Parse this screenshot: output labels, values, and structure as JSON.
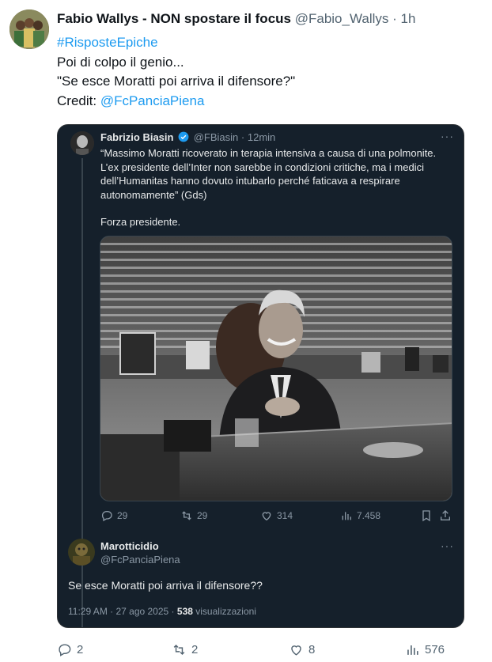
{
  "tweet": {
    "author_name": "Fabio Wallys - NON spostare il focus",
    "author_handle": "@Fabio_Wallys",
    "separator": "·",
    "time": "1h",
    "hashtag": "#RisposteEpiche",
    "line1": "Poi di colpo il genio...",
    "line2": "\"Se esce Moratti poi arriva il difensore?\"",
    "credit_label": "Credit:",
    "credit_mention": "@FcPanciaPiena"
  },
  "quoted": {
    "author_name": "Fabrizio Biasin",
    "author_handle": "@FBiasin",
    "separator": "·",
    "time": "12min",
    "text1": "“Massimo Moratti ricoverato in terapia intensiva a causa di una polmonite. L’ex presidente dell’Inter non sarebbe in condizioni critiche, ma i medici dell’Humanitas hanno dovuto intubarlo perché faticava a respirare autonomamente” (Gds)",
    "text2": "Forza presidente.",
    "more": "···",
    "stats": {
      "replies": "29",
      "reposts": "29",
      "likes": "314",
      "views": "7.458"
    }
  },
  "reply": {
    "author_name": "Marotticidio",
    "author_handle": "@FcPanciaPiena",
    "more": "···",
    "text": "Se esce Moratti poi arriva il difensore??",
    "timestamp": "11:29 AM · 27 ago 2025 ·",
    "views_count": "538",
    "views_label": "visualizzazioni"
  },
  "actions": {
    "replies": "2",
    "reposts": "2",
    "likes": "8",
    "views": "576"
  },
  "colors": {
    "link": "#1d9bf0",
    "card_bg": "#15202b",
    "verified": "#1d9bf0"
  },
  "icons": [
    "reply-icon",
    "repost-icon",
    "like-icon",
    "views-icon",
    "bookmark-icon",
    "share-icon",
    "verified-badge-icon",
    "more-icon"
  ]
}
